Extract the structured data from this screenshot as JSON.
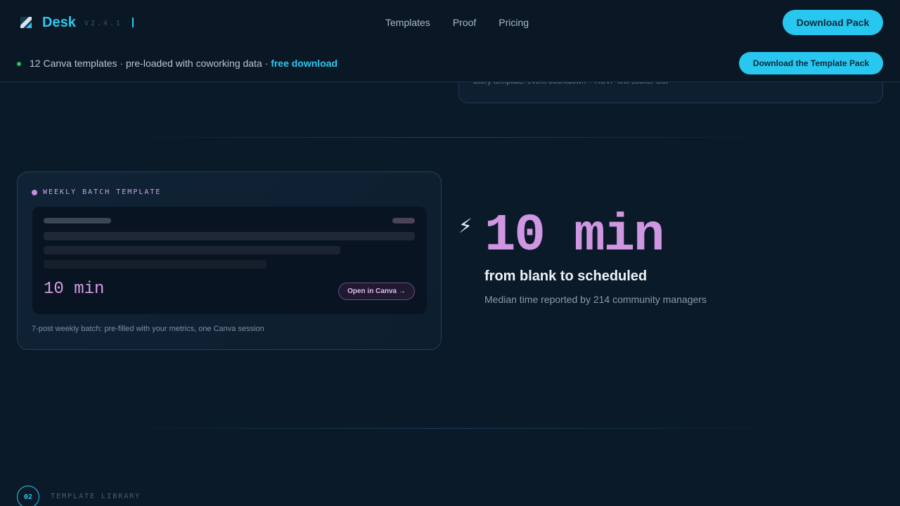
{
  "header": {
    "brand_name": "Desk",
    "version": "V2.4.1",
    "nav": [
      "Templates",
      "Proof",
      "Pricing"
    ],
    "cta_label": "Download Pack"
  },
  "announcement": {
    "text": "12 Canva templates · pre-loaded with coworking data · ",
    "link_text": "free download",
    "cta_label": "Download the Template Pack"
  },
  "story_card": {
    "caption": "Story template: event countdown + RSVP link sticker slot"
  },
  "weekly_card": {
    "label": "WEEKLY BATCH TEMPLATE",
    "preview_stat": "10 min",
    "open_button": "Open in Canva →",
    "caption": "7-post weekly batch: pre-filled with your metrics, one Canva session"
  },
  "stat": {
    "icon": "lightning-icon",
    "bolt": "⚡",
    "value": "10 min",
    "heading": "from blank to scheduled",
    "subtext": "Median time reported by 214 community managers"
  },
  "section": {
    "number": "02",
    "label": "TEMPLATE LIBRARY"
  },
  "colors": {
    "background": "#0b1a29",
    "accent": "#28c7f0",
    "stat_purple": "#cf97e2",
    "status_green": "#22c55e"
  }
}
